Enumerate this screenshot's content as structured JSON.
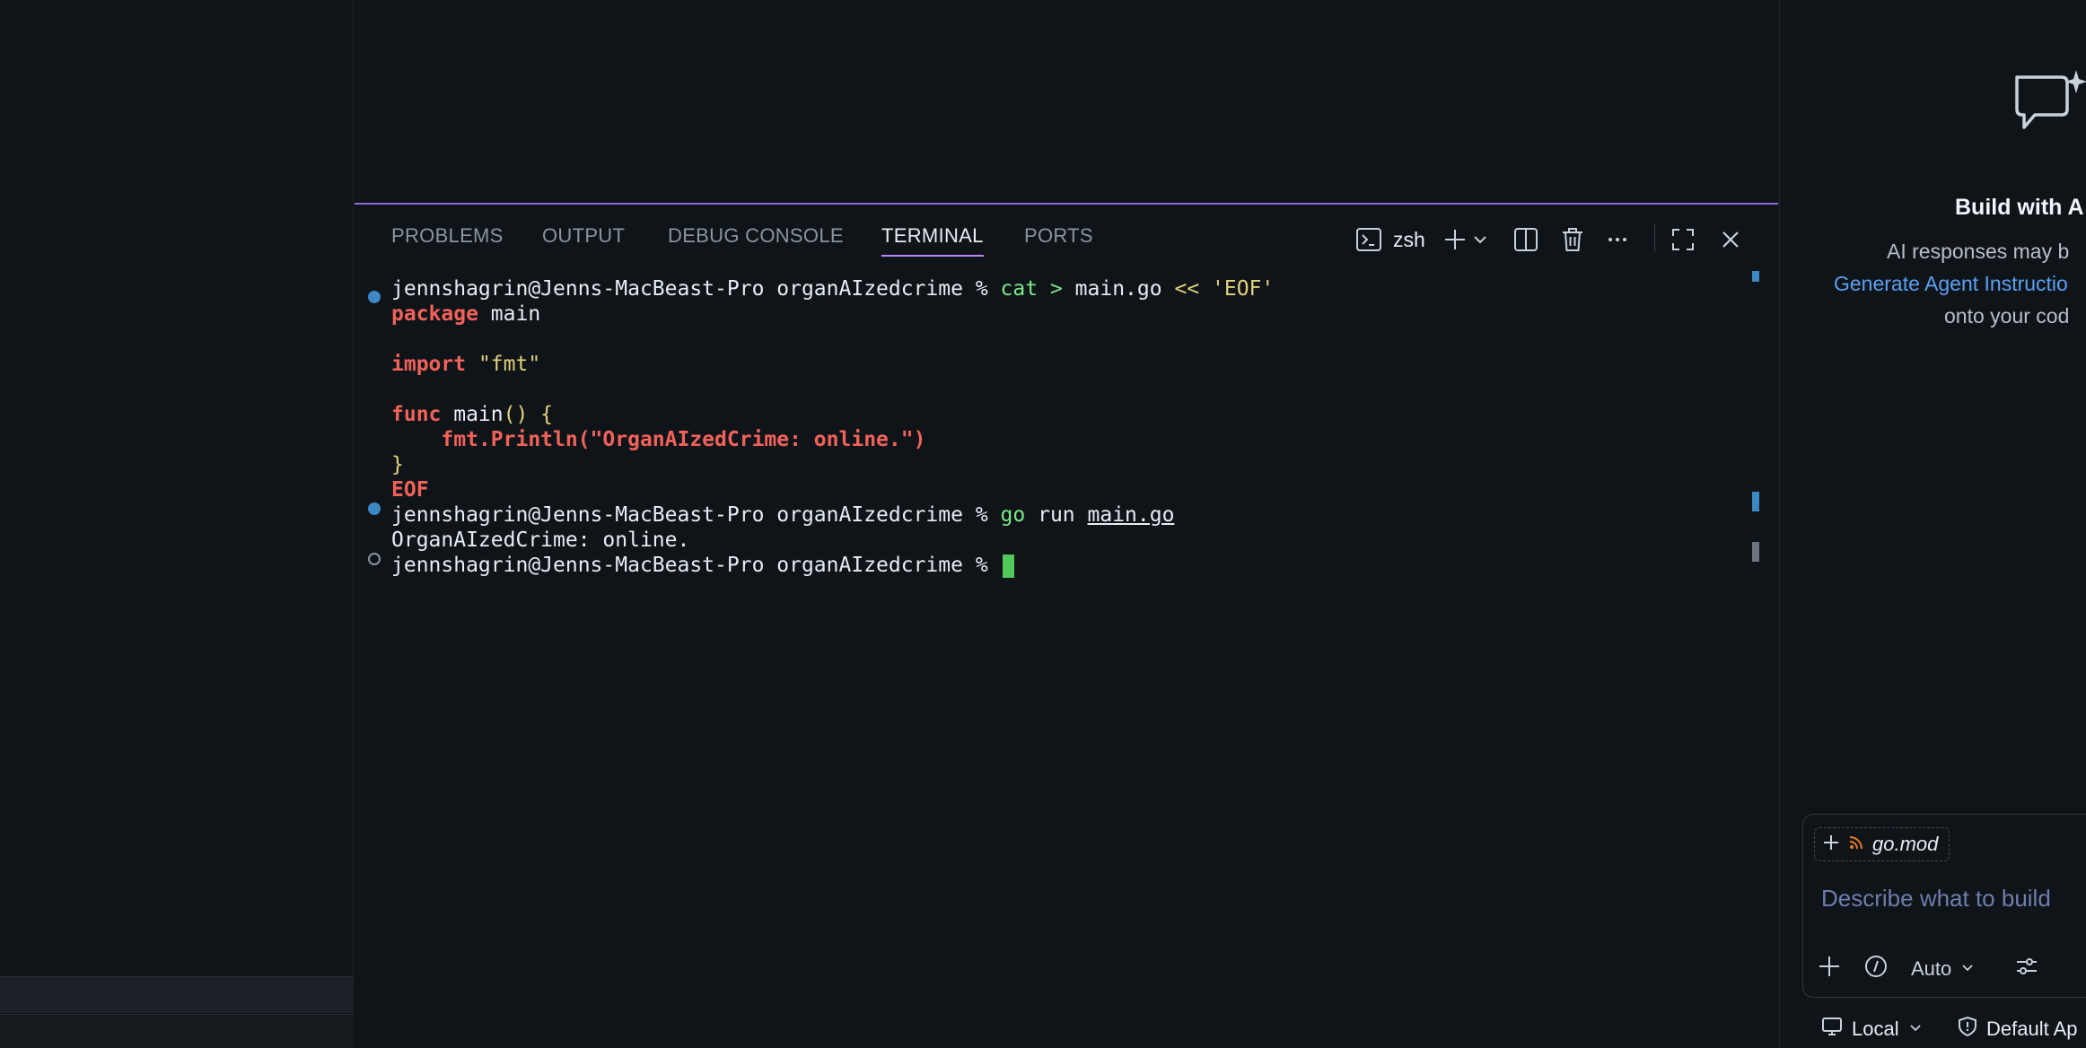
{
  "panel": {
    "tabs": [
      {
        "label": "PROBLEMS"
      },
      {
        "label": "OUTPUT"
      },
      {
        "label": "DEBUG CONSOLE"
      },
      {
        "label": "TERMINAL",
        "active": true
      },
      {
        "label": "PORTS"
      }
    ],
    "toolbar": {
      "shell_label": "zsh",
      "icons": [
        "terminal-icon",
        "plus-icon",
        "chevron-down-icon",
        "split-icon",
        "trash-icon",
        "more-icon",
        "maximize-icon",
        "close-icon"
      ]
    }
  },
  "terminal": {
    "prompt": "jennshagrin@Jenns-MacBeast-Pro organAIzedcrime %",
    "cmd1": {
      "name": "cat",
      "redirect": ">",
      "file": "main.go",
      "heredoc": "<<",
      "delim": "'EOF'"
    },
    "heredoc_lines": {
      "kw_package": "package",
      "pkg_name": " main",
      "kw_import": "import",
      "import_path": " \"fmt\"",
      "kw_func": "func",
      "func_name": " main",
      "func_sig": "() {",
      "println": "    fmt.Println(\"OrganAIzedCrime: online.\")",
      "close_brace": "}",
      "eof": "EOF"
    },
    "cmd2": {
      "name": "go",
      "arg": "run",
      "file": "main.go"
    },
    "output": "OrganAIzedCrime: online."
  },
  "chat": {
    "title": "Build with A",
    "subtitle": "AI responses may b",
    "link": "Generate Agent Instructio",
    "subtitle2": "onto your cod",
    "context_file": "go.mod",
    "placeholder": "Describe what to build",
    "mode": "Auto",
    "status_local": "Local",
    "status_default": "Default Ap"
  },
  "colors": {
    "accent_purple": "#c084fc",
    "prompt_dot": "#3d87c5",
    "cursor": "#52c75a",
    "keyword_red": "#f0625a",
    "string_yellow": "#e3d27a",
    "command_green": "#7ee787",
    "link_blue": "#5aa0f2"
  }
}
